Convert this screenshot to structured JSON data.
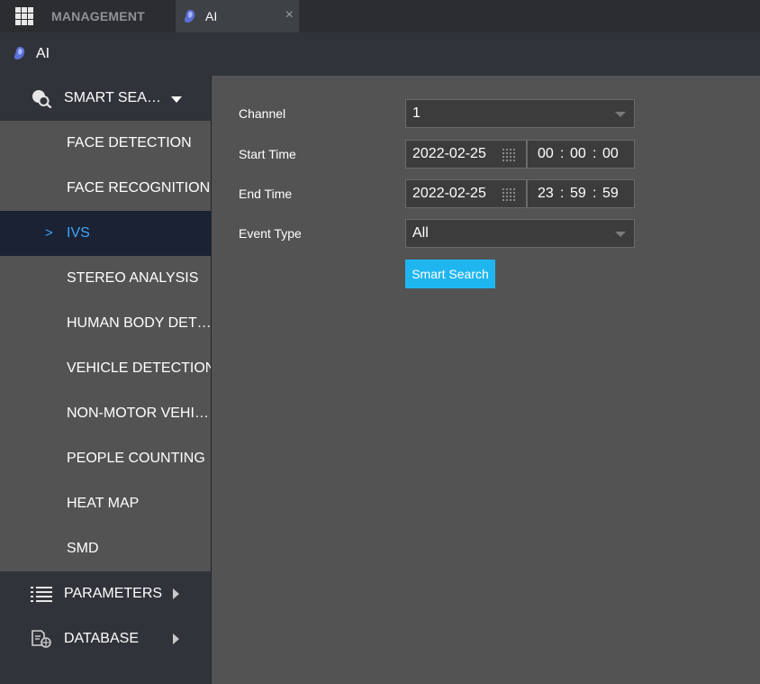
{
  "tabs": {
    "management": "MANAGEMENT",
    "ai": "AI",
    "close": "×"
  },
  "header": {
    "title": "AI"
  },
  "sidebar": {
    "groups": [
      {
        "label": "SMART SEA…",
        "icon": "smart-search-icon",
        "expanded": true
      },
      {
        "label": "PARAMETERS",
        "icon": "list-icon",
        "expanded": false
      },
      {
        "label": "DATABASE",
        "icon": "database-icon",
        "expanded": false
      }
    ],
    "items": [
      {
        "label": "FACE DETECTION"
      },
      {
        "label": "FACE RECOGNITION"
      },
      {
        "label": "IVS",
        "active": true
      },
      {
        "label": "STEREO ANALYSIS"
      },
      {
        "label": "HUMAN BODY DET…"
      },
      {
        "label": "VEHICLE DETECTION"
      },
      {
        "label": "NON-MOTOR VEHI…"
      },
      {
        "label": "PEOPLE COUNTING"
      },
      {
        "label": "HEAT MAP"
      },
      {
        "label": "SMD"
      }
    ],
    "active_chevron": ">"
  },
  "form": {
    "channel_label": "Channel",
    "channel_value": "1",
    "start_label": "Start Time",
    "start_date": "2022-02-25",
    "start_h": "00",
    "start_m": "00",
    "start_s": "00",
    "end_label": "End Time",
    "end_date": "2022-02-25",
    "end_h": "23",
    "end_m": "59",
    "end_s": "59",
    "time_sep": ":",
    "event_label": "Event Type",
    "event_value": "All",
    "search_button": "Smart Search"
  },
  "colors": {
    "accent": "#1fb6f0",
    "active_text": "#3ea6ff",
    "active_bg": "#1b2233"
  }
}
